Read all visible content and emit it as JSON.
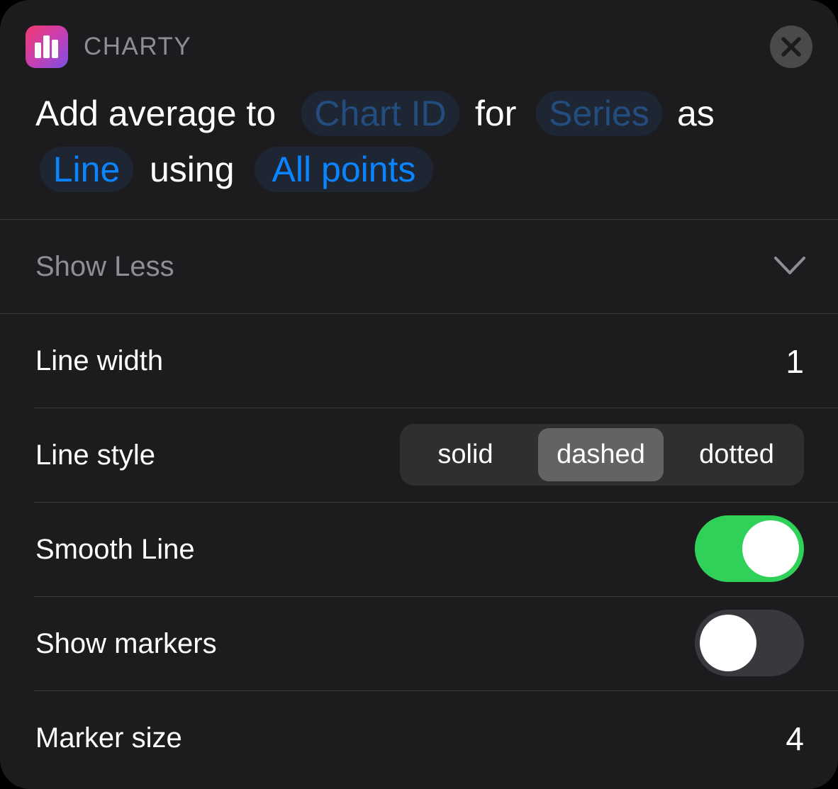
{
  "header": {
    "app_name": "CHARTY",
    "app_icon": "bar-chart-icon",
    "close_icon": "close-icon"
  },
  "action": {
    "word_add_average_to": "Add average to",
    "chart_id_placeholder": "Chart ID",
    "word_for": "for",
    "series_placeholder": "Series",
    "word_as": "as",
    "type_value": "Line",
    "word_using": "using",
    "points_value": "All points"
  },
  "show_less": {
    "label": "Show Less",
    "icon": "chevron-down-icon"
  },
  "params": {
    "line_width": {
      "label": "Line width",
      "value": "1"
    },
    "line_style": {
      "label": "Line style",
      "options": [
        "solid",
        "dashed",
        "dotted"
      ],
      "selected": "dashed"
    },
    "smooth_line": {
      "label": "Smooth Line",
      "on": true
    },
    "show_markers": {
      "label": "Show markers",
      "on": false
    },
    "marker_size": {
      "label": "Marker size",
      "value": "4"
    }
  },
  "colors": {
    "background": "#1c1c1e",
    "accent": "#0a84ff",
    "placeholder": "#234d7e",
    "toggle_on": "#30d158",
    "secondary_text": "#8e8e93"
  }
}
